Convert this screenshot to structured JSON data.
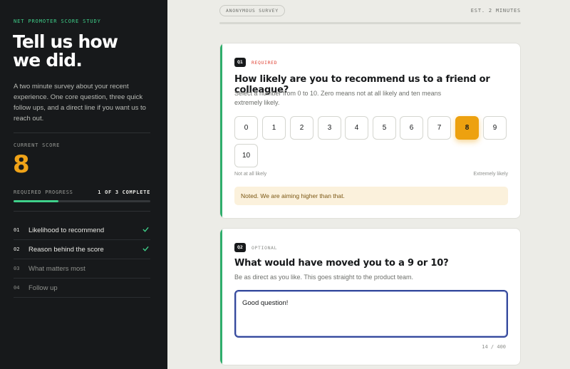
{
  "sidebar": {
    "eyebrow": "NET PROMOTER SCORE STUDY",
    "headline_line1": "Tell us how",
    "headline_line2": "we did.",
    "intro": "A two minute survey about your recent experience. One core question, three quick follow ups, and a direct line if you want us to reach out.",
    "score_label": "CURRENT SCORE",
    "score_value": "8",
    "progress_label": "REQUIRED PROGRESS",
    "progress_count": "1 OF 3 COMPLETE",
    "progress_fraction": 0.33,
    "steps": [
      {
        "num": "01",
        "label": "Likelihood to recommend",
        "done": true
      },
      {
        "num": "02",
        "label": "Reason behind the score",
        "done": true
      },
      {
        "num": "03",
        "label": "What matters most",
        "done": false
      },
      {
        "num": "04",
        "label": "Follow up",
        "done": false
      }
    ]
  },
  "header": {
    "badge": "ANONYMOUS SURVEY",
    "estimate": "EST. 2 MINUTES"
  },
  "q1": {
    "tag": "Q1",
    "requirement": "REQUIRED",
    "title": "How likely are you to recommend us to a friend or colleague?",
    "subtitle": "Select a number from 0 to 10. Zero means not at all likely and ten means extremely likely.",
    "options": [
      "0",
      "1",
      "2",
      "3",
      "4",
      "5",
      "6",
      "7",
      "8",
      "9",
      "10"
    ],
    "selected": "8",
    "low_label": "Not at all likely",
    "high_label": "Extremely likely",
    "feedback": "Noted. We are aiming higher than that."
  },
  "q2": {
    "tag": "Q2",
    "requirement": "OPTIONAL",
    "title": "What would have moved you to a 9 or 10?",
    "subtitle": "Be as direct as you like. This goes straight to the product team.",
    "answer": "Good question!",
    "counter": "14 / 400"
  },
  "colors": {
    "accent_green": "#3fd08a",
    "score_orange": "#f0a318",
    "selected_orange": "#eda10f",
    "required_red": "#e0483a",
    "sidebar_bg": "#17191b",
    "focus_blue": "#34489b"
  }
}
